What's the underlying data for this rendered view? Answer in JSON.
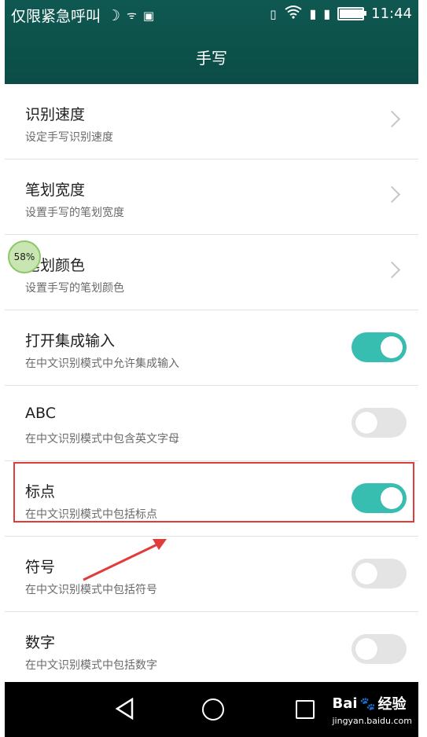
{
  "status_bar": {
    "carrier": "仅限紧急呼叫",
    "time": "11:44",
    "battery_level": 0.95,
    "icons": [
      "moon-icon",
      "wifi-weak-icon",
      "image-icon",
      "vibrate-icon",
      "wifi-icon",
      "sim1-icon",
      "sim2-icon",
      "battery-icon"
    ]
  },
  "header": {
    "title": "手写"
  },
  "settings": [
    {
      "title": "识别速度",
      "subtitle": "设定手写识别速度",
      "control": "chevron"
    },
    {
      "title": "笔划宽度",
      "subtitle": "设置手写的笔划宽度",
      "control": "chevron"
    },
    {
      "title": "笔划颜色",
      "subtitle": "设置手写的笔划颜色",
      "control": "chevron"
    },
    {
      "title": "打开集成输入",
      "subtitle": "在中文识别模式中允许集成输入",
      "control": "toggle",
      "on": true
    },
    {
      "title": "ABC",
      "subtitle": "在中文识别模式中包含英文字母",
      "control": "toggle",
      "on": false
    },
    {
      "title": "标点",
      "subtitle": "在中文识别模式中包括标点",
      "control": "toggle",
      "on": true
    },
    {
      "title": "符号",
      "subtitle": "在中文识别模式中包括符号",
      "control": "toggle",
      "on": false
    },
    {
      "title": "数字",
      "subtitle": "在中文识别模式中包括数字",
      "control": "toggle",
      "on": false
    }
  ],
  "overlay_badge": {
    "text": "58%"
  },
  "watermark": {
    "brand": "Bai",
    "brand_suffix": "经验",
    "url": "jingyan.baidu.com"
  },
  "colors": {
    "appbar": "#0f5851",
    "toggle_on": "#38bdb1",
    "toggle_off": "#e4e4e4",
    "highlight": "#e23b3b"
  }
}
